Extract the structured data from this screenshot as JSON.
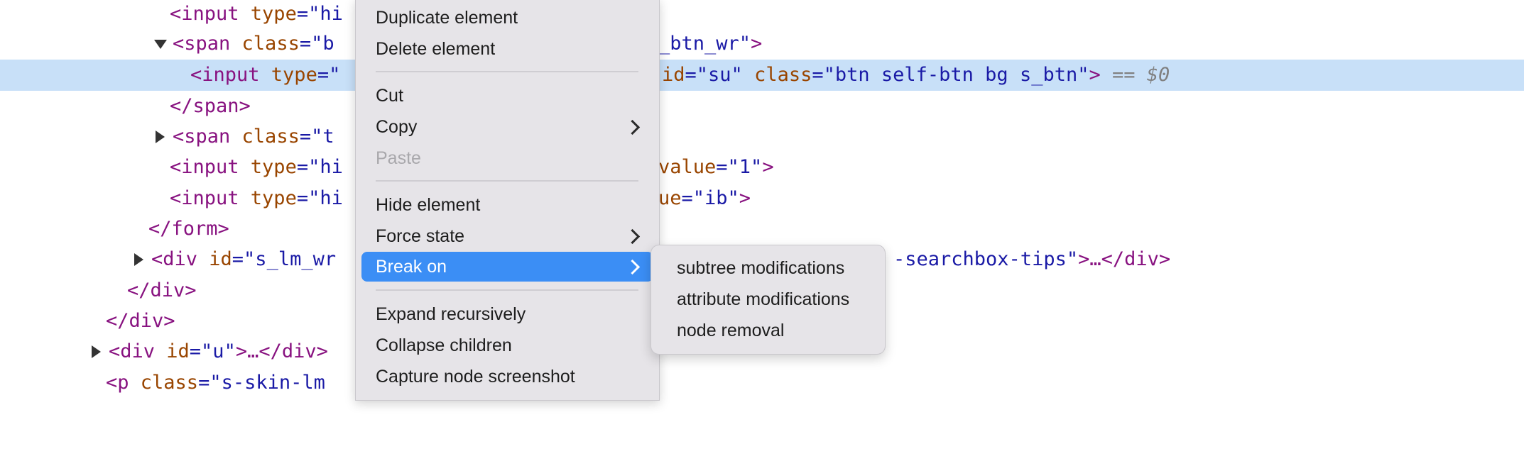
{
  "code_lines": [
    {
      "parts": [
        {
          "t": "<input ",
          "c": "tag"
        },
        {
          "t": "type",
          "c": "attr"
        },
        {
          "t": "=\"hi",
          "c": "val"
        }
      ]
    },
    {
      "parts": [
        {
          "t": "<span ",
          "c": "tag"
        },
        {
          "t": "class",
          "c": "attr"
        },
        {
          "t": "=\"b",
          "c": "val"
        }
      ]
    },
    {
      "parts": [
        {
          "t": "<input ",
          "c": "tag"
        },
        {
          "t": "type",
          "c": "attr"
        },
        {
          "t": "=\"",
          "c": "val"
        }
      ]
    },
    {
      "parts": [
        {
          "t": "</span>",
          "c": "tag"
        }
      ]
    },
    {
      "parts": [
        {
          "t": "<span ",
          "c": "tag"
        },
        {
          "t": "class",
          "c": "attr"
        },
        {
          "t": "=\"t",
          "c": "val"
        }
      ]
    },
    {
      "parts": [
        {
          "t": "<input ",
          "c": "tag"
        },
        {
          "t": "type",
          "c": "attr"
        },
        {
          "t": "=\"hi",
          "c": "val"
        }
      ]
    },
    {
      "parts": [
        {
          "t": "<input ",
          "c": "tag"
        },
        {
          "t": "type",
          "c": "attr"
        },
        {
          "t": "=\"hi",
          "c": "val"
        }
      ]
    },
    {
      "parts": [
        {
          "t": "</form>",
          "c": "tag"
        }
      ]
    },
    {
      "parts": [
        {
          "t": "<div ",
          "c": "tag"
        },
        {
          "t": "id",
          "c": "attr"
        },
        {
          "t": "=\"s_lm_wr",
          "c": "val"
        }
      ]
    },
    {
      "parts": [
        {
          "t": "</div>",
          "c": "tag"
        }
      ]
    },
    {
      "parts": [
        {
          "t": "</div>",
          "c": "tag"
        }
      ]
    },
    {
      "parts": [
        {
          "t": "<div ",
          "c": "tag"
        },
        {
          "t": "id",
          "c": "attr"
        },
        {
          "t": "=\"u\"",
          "c": "val"
        },
        {
          "t": ">…</div>",
          "c": "tag"
        }
      ]
    },
    {
      "parts": [
        {
          "t": "<p ",
          "c": "tag"
        },
        {
          "t": "class",
          "c": "attr"
        },
        {
          "t": "=\"s-skin-lm",
          "c": "val"
        }
      ]
    }
  ],
  "code_tails": [
    {
      "line": 1,
      "parts": [
        {
          "t": "_btn_wr\"",
          "c": "val"
        },
        {
          "t": ">",
          "c": "tag"
        }
      ]
    },
    {
      "line": 2,
      "parts": [
        {
          "t": "id",
          "c": "attr"
        },
        {
          "t": "=\"su\" ",
          "c": "val"
        },
        {
          "t": "class",
          "c": "attr"
        },
        {
          "t": "=\"btn self-btn bg s_btn\"",
          "c": "val"
        },
        {
          "t": ">",
          "c": "tag"
        },
        {
          "t": " == ",
          "c": "eq"
        },
        {
          "t": "$0",
          "c": "dollar"
        }
      ]
    },
    {
      "line": 5,
      "parts": [
        {
          "t": "value",
          "c": "attr"
        },
        {
          "t": "=\"1\"",
          "c": "val"
        },
        {
          "t": ">",
          "c": "tag"
        }
      ]
    },
    {
      "line": 6,
      "parts": [
        {
          "t": "ue",
          "c": "attr"
        },
        {
          "t": "=\"ib\"",
          "c": "val"
        },
        {
          "t": ">",
          "c": "tag"
        }
      ]
    },
    {
      "line": 8,
      "parts": [
        {
          "t": "-searchbox-tips\"",
          "c": "val"
        },
        {
          "t": ">…</div>",
          "c": "tag"
        }
      ]
    }
  ],
  "context_menu": {
    "items": [
      {
        "label": "Duplicate element"
      },
      {
        "label": "Delete element"
      },
      {
        "label": "Cut"
      },
      {
        "label": "Copy"
      },
      {
        "label": "Paste"
      },
      {
        "label": "Hide element"
      },
      {
        "label": "Force state"
      },
      {
        "label": "Break on"
      },
      {
        "label": "Expand recursively"
      },
      {
        "label": "Collapse children"
      },
      {
        "label": "Capture node screenshot"
      }
    ]
  },
  "submenu": {
    "items": [
      {
        "label": "subtree modifications"
      },
      {
        "label": "attribute modifications"
      },
      {
        "label": "node removal"
      }
    ]
  },
  "colors": {
    "selected_row": "#c8e0f8",
    "menu_highlight": "#3b8ef5",
    "tag": "#881280",
    "attribute": "#994500",
    "value": "#1a1aa6"
  },
  "icons": [
    "disclosure-triangle-icon",
    "chevron-right-icon"
  ]
}
